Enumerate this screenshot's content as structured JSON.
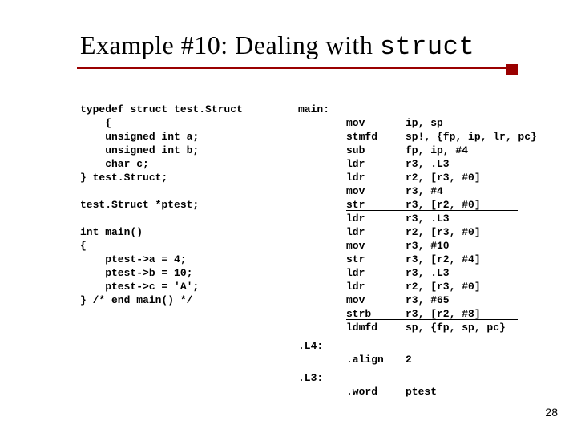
{
  "title_prefix": "Example #10: Dealing with ",
  "title_kw": "struct",
  "page_number": "28",
  "c_code": "typedef struct test.Struct\n    {\n    unsigned int a;\n    unsigned int b;\n    char c;\n} test.Struct;\n\ntest.Struct *ptest;\n\nint main()\n{\n    ptest->a = 4;\n    ptest->b = 10;\n    ptest->c = 'A';\n} /* end main() */",
  "asm": [
    {
      "label": "main:",
      "op": "",
      "args": ""
    },
    {
      "label": "",
      "op": "mov",
      "args": "ip, sp"
    },
    {
      "label": "",
      "op": "stmfd",
      "args": "sp!, {fp, ip, lr, pc}"
    },
    {
      "label": "",
      "op": "sub",
      "args": "fp, ip, #4"
    },
    {
      "label": "",
      "op": "ldr",
      "args": "r3, .L3"
    },
    {
      "label": "",
      "op": "ldr",
      "args": "r2, [r3, #0]"
    },
    {
      "label": "",
      "op": "mov",
      "args": "r3, #4"
    },
    {
      "label": "",
      "op": "str",
      "args": "r3, [r2, #0]"
    },
    {
      "label": "",
      "op": "ldr",
      "args": "r3, .L3"
    },
    {
      "label": "",
      "op": "ldr",
      "args": "r2, [r3, #0]"
    },
    {
      "label": "",
      "op": "mov",
      "args": "r3, #10"
    },
    {
      "label": "",
      "op": "str",
      "args": "r3, [r2, #4]"
    },
    {
      "label": "",
      "op": "ldr",
      "args": "r3, .L3"
    },
    {
      "label": "",
      "op": "ldr",
      "args": "r2, [r3, #0]"
    },
    {
      "label": "",
      "op": "mov",
      "args": "r3, #65"
    },
    {
      "label": "",
      "op": "strb",
      "args": "r3, [r2, #8]"
    },
    {
      "label": "",
      "op": "ldmfd",
      "args": "sp, {fp, sp, pc}"
    },
    {
      "label": ".L4:",
      "op": "",
      "args": ""
    },
    {
      "label": "",
      "op": ".align",
      "args": "2"
    },
    {
      "label": ".L3:",
      "op": "",
      "args": ""
    },
    {
      "label": "",
      "op": ".word",
      "args": "ptest"
    }
  ],
  "underline_rows": [
    3,
    7,
    11,
    15
  ]
}
